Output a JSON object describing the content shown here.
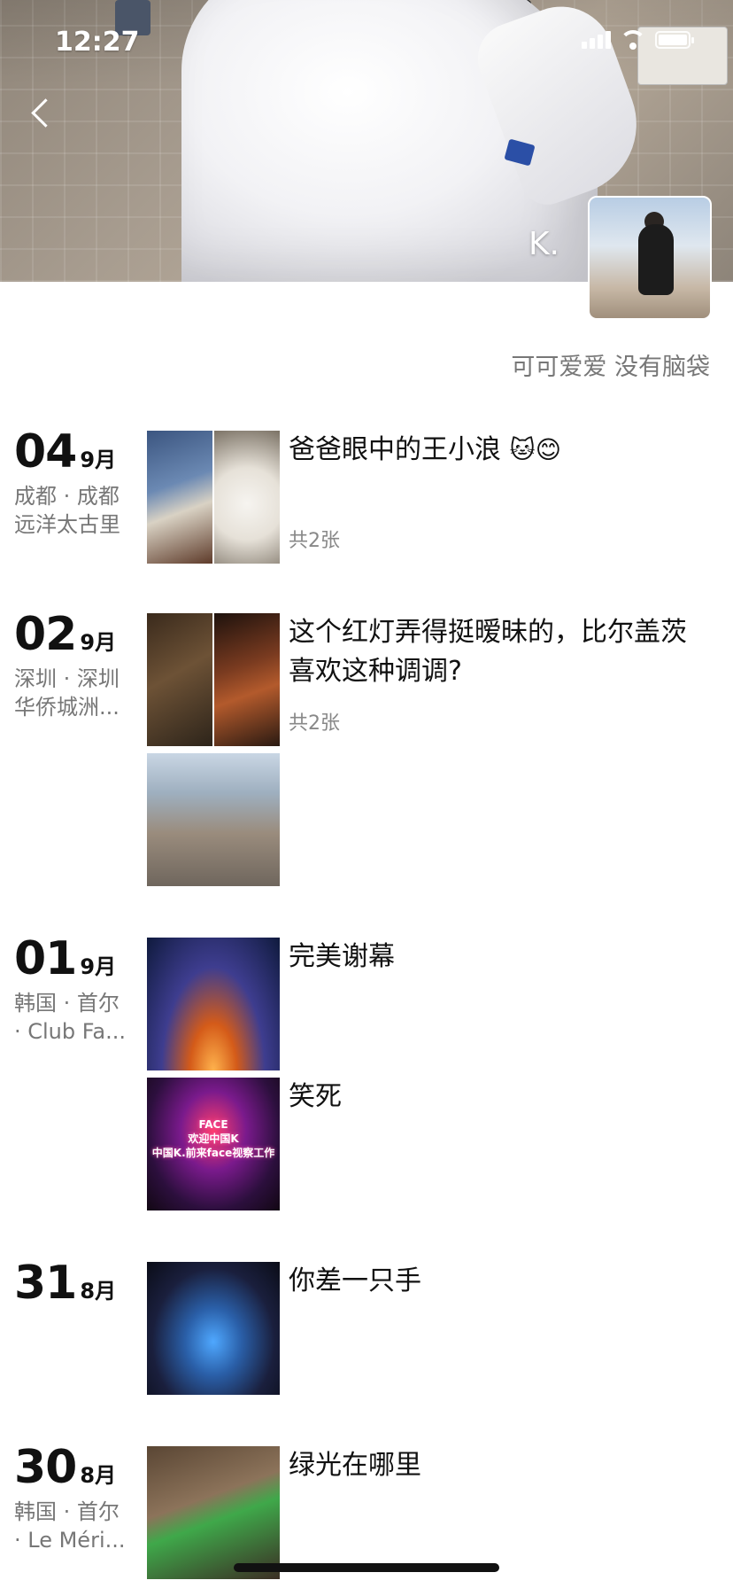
{
  "status_bar": {
    "time": "12:27"
  },
  "profile": {
    "nickname": "K.",
    "signature": "可可爱爱 没有脑袋"
  },
  "posts": [
    {
      "day": "04",
      "month": "9月",
      "location": [
        "成都 · 成都",
        "远洋太古里"
      ],
      "items": [
        {
          "caption": "爸爸眼中的王小浪",
          "emoji": "🐱😊",
          "count": "共2张"
        }
      ]
    },
    {
      "day": "02",
      "month": "9月",
      "location": [
        "深圳 · 深圳",
        "华侨城洲..."
      ],
      "items": [
        {
          "caption": "这个红灯弄得挺暧昧的，比尔盖茨喜欢这种调调?",
          "count": "共2张"
        },
        {
          "caption": ""
        }
      ]
    },
    {
      "day": "01",
      "month": "9月",
      "location": [
        "韩国 · 首尔",
        "· Club Fa..."
      ],
      "items": [
        {
          "caption": "完美谢幕"
        },
        {
          "caption": "笑死",
          "photo_text": [
            "FACE",
            "欢迎中国K",
            "中国K.前来face视察工作"
          ]
        }
      ]
    },
    {
      "day": "31",
      "month": "8月",
      "location": [],
      "items": [
        {
          "caption": "你差一只手"
        }
      ]
    },
    {
      "day": "30",
      "month": "8月",
      "location": [
        "韩国 · 首尔",
        "· Le Méri..."
      ],
      "items": [
        {
          "caption": "绿光在哪里"
        }
      ]
    }
  ]
}
